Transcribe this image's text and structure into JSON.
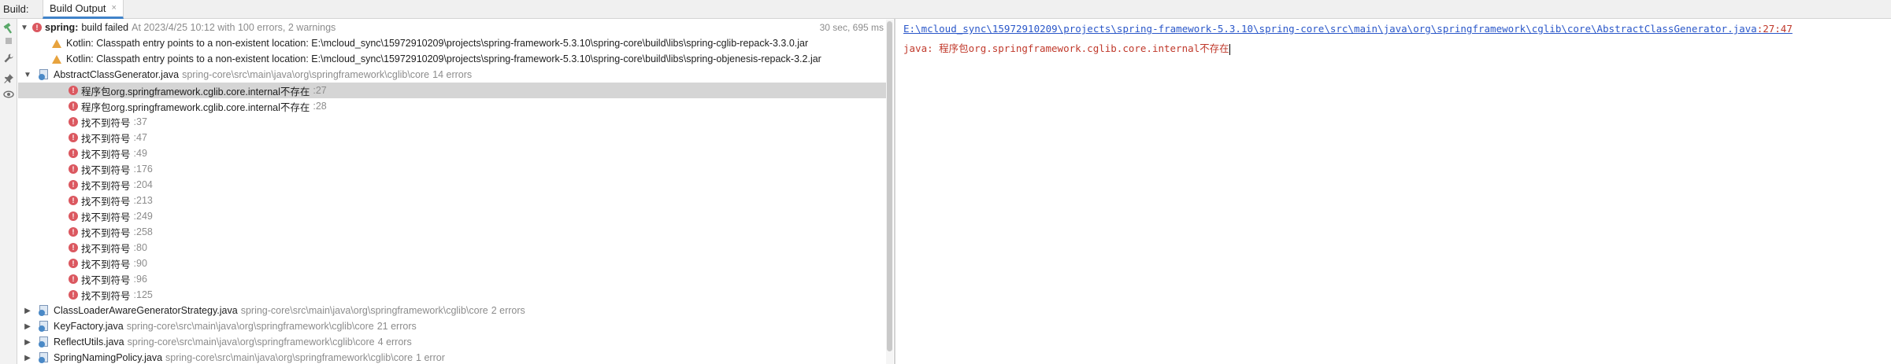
{
  "topbar": {
    "title": "Build:",
    "tab_label": "Build Output",
    "tab_close": "×"
  },
  "toolbar": {
    "tools": [
      "hammer-icon",
      "stop-icon",
      "wrench-icon",
      "pin-icon",
      "eye-icon"
    ]
  },
  "tree": {
    "root": {
      "project": "spring:",
      "status": "build failed",
      "details": "At 2023/4/25 10:12 with 100 errors, 2 warnings",
      "time": "30 sec, 695 ms"
    },
    "warnings": [
      "Kotlin: Classpath entry points to a non-existent location: E:\\mcloud_sync\\15972910209\\projects\\spring-framework-5.3.10\\spring-core\\build\\libs\\spring-cglib-repack-3.3.0.jar",
      "Kotlin: Classpath entry points to a non-existent location: E:\\mcloud_sync\\15972910209\\projects\\spring-framework-5.3.10\\spring-core\\build\\libs\\spring-objenesis-repack-3.2.jar"
    ],
    "file_expanded": {
      "name": "AbstractClassGenerator.java",
      "path": "spring-core\\src\\main\\java\\org\\springframework\\cglib\\core",
      "count": "14 errors"
    },
    "errors": [
      {
        "msg": "程序包org.springframework.cglib.core.internal不存在",
        "line": ":27"
      },
      {
        "msg": "程序包org.springframework.cglib.core.internal不存在",
        "line": ":28"
      },
      {
        "msg": "找不到符号",
        "line": ":37"
      },
      {
        "msg": "找不到符号",
        "line": ":47"
      },
      {
        "msg": "找不到符号",
        "line": ":49"
      },
      {
        "msg": "找不到符号",
        "line": ":176"
      },
      {
        "msg": "找不到符号",
        "line": ":204"
      },
      {
        "msg": "找不到符号",
        "line": ":213"
      },
      {
        "msg": "找不到符号",
        "line": ":249"
      },
      {
        "msg": "找不到符号",
        "line": ":258"
      },
      {
        "msg": "找不到符号",
        "line": ":80"
      },
      {
        "msg": "找不到符号",
        "line": ":90"
      },
      {
        "msg": "找不到符号",
        "line": ":96"
      },
      {
        "msg": "找不到符号",
        "line": ":125"
      }
    ],
    "files_collapsed": [
      {
        "name": "ClassLoaderAwareGeneratorStrategy.java",
        "path": "spring-core\\src\\main\\java\\org\\springframework\\cglib\\core",
        "count": "2 errors"
      },
      {
        "name": "KeyFactory.java",
        "path": "spring-core\\src\\main\\java\\org\\springframework\\cglib\\core",
        "count": "21 errors"
      },
      {
        "name": "ReflectUtils.java",
        "path": "spring-core\\src\\main\\java\\org\\springframework\\cglib\\core",
        "count": "4 errors"
      },
      {
        "name": "SpringNamingPolicy.java",
        "path": "spring-core\\src\\main\\java\\org\\springframework\\cglib\\core",
        "count": "1 error"
      }
    ]
  },
  "console": {
    "link": "E:\\mcloud_sync\\15972910209\\projects\\spring-framework-5.3.10\\spring-core\\src\\main\\java\\org\\springframework\\cglib\\core\\AbstractClassGenerator.java",
    "link_pos": ":27:47",
    "message": "java: 程序包org.springframework.cglib.core.internal不存在"
  },
  "colors": {
    "error": "#db5860",
    "warning": "#e7a33e",
    "link": "#2a57c9",
    "error_text": "#c0392b",
    "selection": "#d5d5d5",
    "tab_underline": "#4083c9"
  }
}
